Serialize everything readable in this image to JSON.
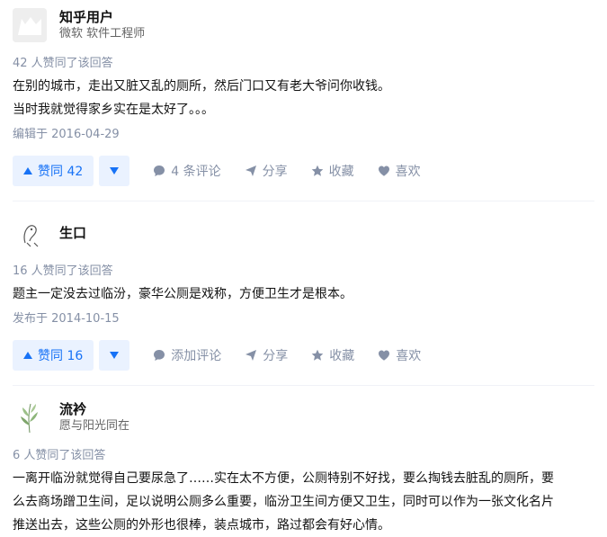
{
  "answers": [
    {
      "author": "知乎用户",
      "bio": "微软 软件工程师",
      "vote_meta": "42 人赞同了该回答",
      "content": [
        "在别的城市，走出又脏又乱的厕所，然后门口又有老大爷问你收钱。",
        "当时我就觉得家乡实在是太好了。。。"
      ],
      "time": "编辑于 2016-04-29",
      "upvote": "赞同 42",
      "comment": "4 条评论",
      "share": "分享",
      "collect": "收藏",
      "like": "喜欢"
    },
    {
      "author": "生口",
      "bio": "",
      "vote_meta": "16 人赞同了该回答",
      "content": [
        "题主一定没去过临汾，豪华公厕是戏称，方便卫生才是根本。"
      ],
      "time": "发布于 2014-10-15",
      "upvote": "赞同 16",
      "comment": "添加评论",
      "share": "分享",
      "collect": "收藏",
      "like": "喜欢"
    },
    {
      "author": "流衿",
      "bio": "愿与阳光同在",
      "vote_meta": "6 人赞同了该回答",
      "content": [
        "一离开临汾就觉得自己要尿急了……实在太不方便，公厕特别不好找，要么掏钱去脏乱的厕所，要",
        "么去商场蹭卫生间，足以说明公厕多么重要，临汾卫生间方便又卫生，同时可以作为一张文化名片",
        "推送出去，这些公厕的外形也很棒，装点城市，路过都会有好心情。"
      ]
    }
  ],
  "colors": {
    "accent": "#1772f6",
    "accent_bg": "#eaf2ff",
    "meta": "#8590a6"
  }
}
